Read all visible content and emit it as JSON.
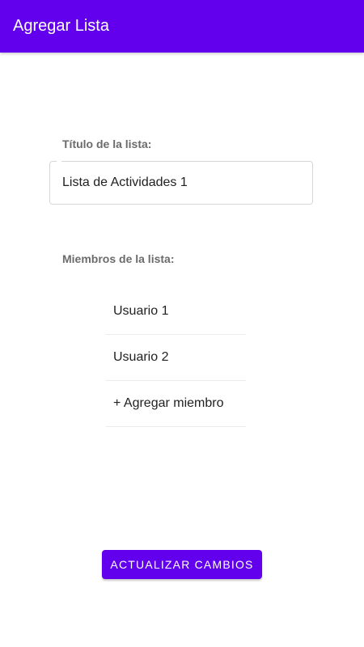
{
  "app_bar": {
    "title": "Agregar Lista"
  },
  "form": {
    "title_label": "Título de la lista:",
    "title_value": "Lista de Actividades 1",
    "members_label": "Miembros de la lista:",
    "members": [
      {
        "label": "Usuario 1"
      },
      {
        "label": "Usuario 2"
      }
    ],
    "add_member_label": "+ Agregar miembro"
  },
  "actions": {
    "update_label": "ACTUALIZAR CAMBIOS"
  },
  "colors": {
    "primary": "#6200ee",
    "on_primary": "#ffffff",
    "label_text": "#6b6b6b",
    "body_text": "#212121"
  }
}
